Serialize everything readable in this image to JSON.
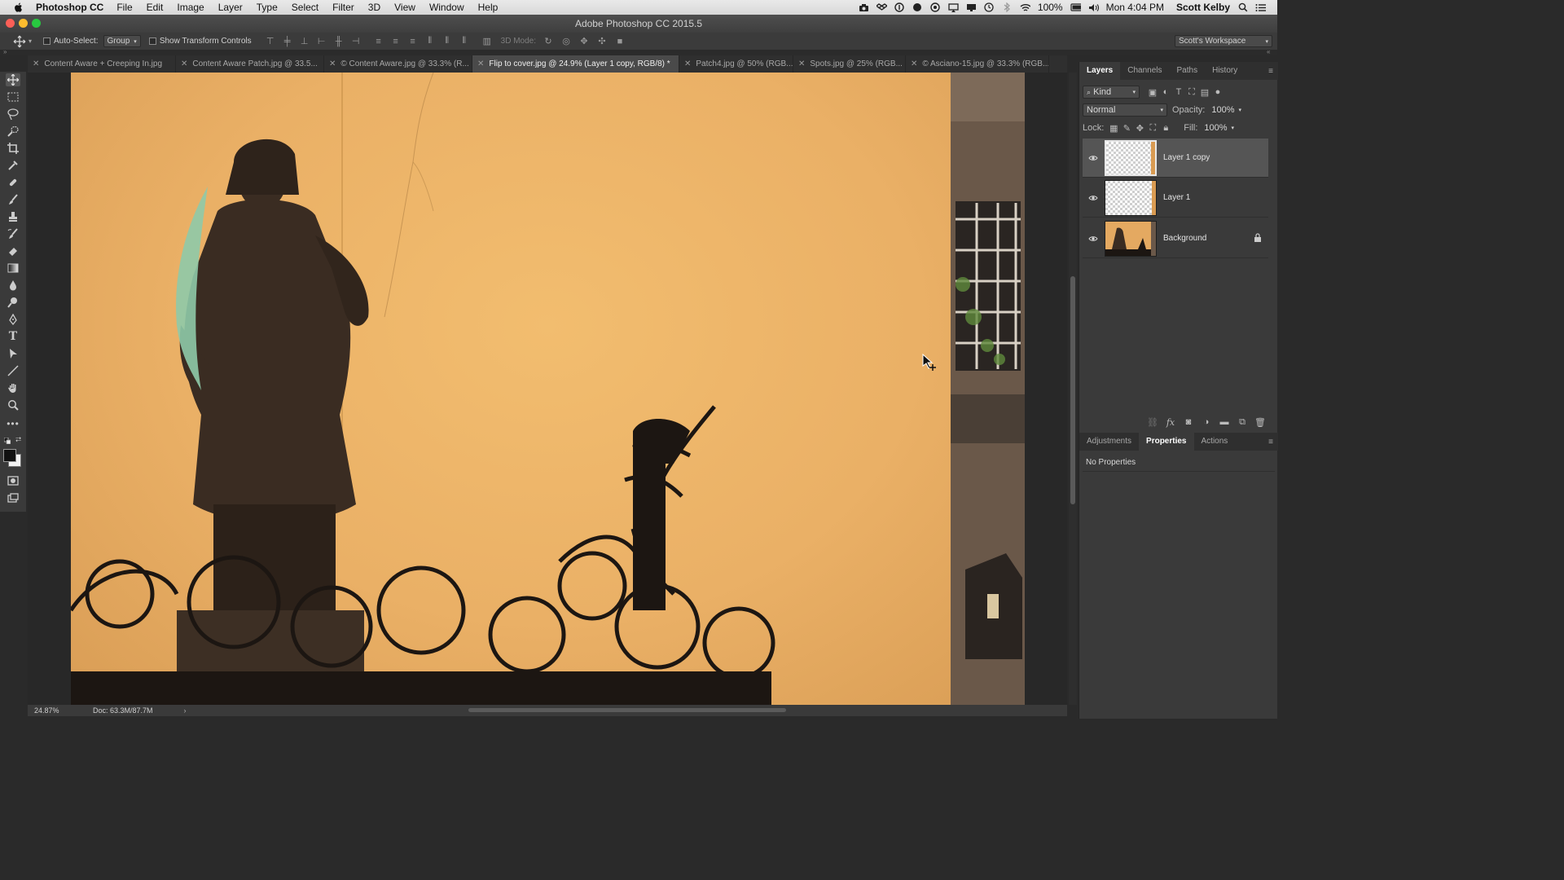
{
  "menubar": {
    "app_name": "Photoshop CC",
    "items": [
      "File",
      "Edit",
      "Image",
      "Layer",
      "Type",
      "Select",
      "Filter",
      "3D",
      "View",
      "Window",
      "Help"
    ],
    "battery": "100%",
    "clock": "Mon 4:04 PM",
    "user": "Scott Kelby"
  },
  "window": {
    "title": "Adobe Photoshop CC 2015.5"
  },
  "options": {
    "auto_select_label": "Auto-Select:",
    "auto_select_value": "Group",
    "transform_label": "Show Transform Controls",
    "mode_3d_label": "3D Mode:",
    "workspace": "Scott's Workspace"
  },
  "tabs": [
    {
      "label": "Content Aware + Creeping In.jpg",
      "active": false
    },
    {
      "label": "Content Aware Patch.jpg @ 33.5...",
      "active": false
    },
    {
      "label": "© Content Aware.jpg @ 33.3% (R...",
      "active": false
    },
    {
      "label": "Flip to cover.jpg @ 24.9% (Layer 1 copy, RGB/8) *",
      "active": true
    },
    {
      "label": "Patch4.jpg @ 50% (RGB...",
      "active": false
    },
    {
      "label": "Spots.jpg @ 25% (RGB...",
      "active": false
    },
    {
      "label": "© Asciano-15.jpg @ 33.3% (RGB...",
      "active": false
    }
  ],
  "status": {
    "zoom": "24.87%",
    "doc": "Doc: 63.3M/87.7M"
  },
  "layers_panel": {
    "tabs": [
      "Layers",
      "Channels",
      "Paths",
      "History"
    ],
    "kind_label": "Kind",
    "blend_mode": "Normal",
    "opacity_label": "Opacity:",
    "opacity_value": "100%",
    "lock_label": "Lock:",
    "fill_label": "Fill:",
    "fill_value": "100%",
    "layers": [
      {
        "name": "Layer 1 copy",
        "selected": true,
        "locked": false
      },
      {
        "name": "Layer 1",
        "selected": false,
        "locked": false
      },
      {
        "name": "Background",
        "selected": false,
        "locked": true
      }
    ]
  },
  "properties_panel": {
    "tabs": [
      "Adjustments",
      "Properties",
      "Actions"
    ],
    "active_tab": "Properties",
    "message": "No Properties"
  },
  "colors": {
    "wall": "#eab066",
    "ui_dark": "#3a3a3a",
    "selected_layer": "#555555"
  }
}
